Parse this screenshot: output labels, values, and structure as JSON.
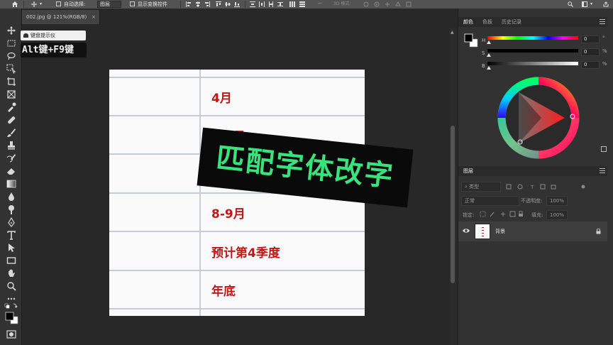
{
  "options_bar": {
    "auto_select_label": "自动选择:",
    "auto_select_target": "图层",
    "show_transform_label": "显示变换控件",
    "mode_3d_label": "3D 模式:"
  },
  "document": {
    "tab_title": "002.jpg @ 121%(RGB/8)",
    "tab_close": "×"
  },
  "keyboard_hint": {
    "title": "键盘提示仪",
    "keys": "Alt键+F9键"
  },
  "canvas_image": {
    "rows": [
      "4月",
      "6-7月",
      "8-9月",
      "预计第4季度",
      "年底"
    ]
  },
  "caption": {
    "text": "匹配字体改字",
    "color": "#39e27d"
  },
  "color_panel": {
    "tabs": [
      "颜色",
      "色板",
      "历史记录"
    ],
    "sliders": [
      {
        "label": "H",
        "value": "0",
        "unit": "°"
      },
      {
        "label": "S",
        "value": "0",
        "unit": "%"
      },
      {
        "label": "B",
        "value": "0",
        "unit": "%"
      }
    ],
    "foreground": "#000000",
    "background": "#ffffff"
  },
  "layers_panel": {
    "title": "图层",
    "filter_label": "类型",
    "blend_mode": "正常",
    "opacity_label": "不透明度:",
    "opacity_value": "100%",
    "lock_label": "锁定:",
    "fill_label": "填充:",
    "fill_value": "100%",
    "layers": [
      {
        "name": "背景",
        "visible": true,
        "locked": true
      }
    ]
  },
  "icons": {
    "home": "home-icon",
    "move": "move-icon",
    "eye": "eye-icon",
    "lock": "lock-icon"
  }
}
